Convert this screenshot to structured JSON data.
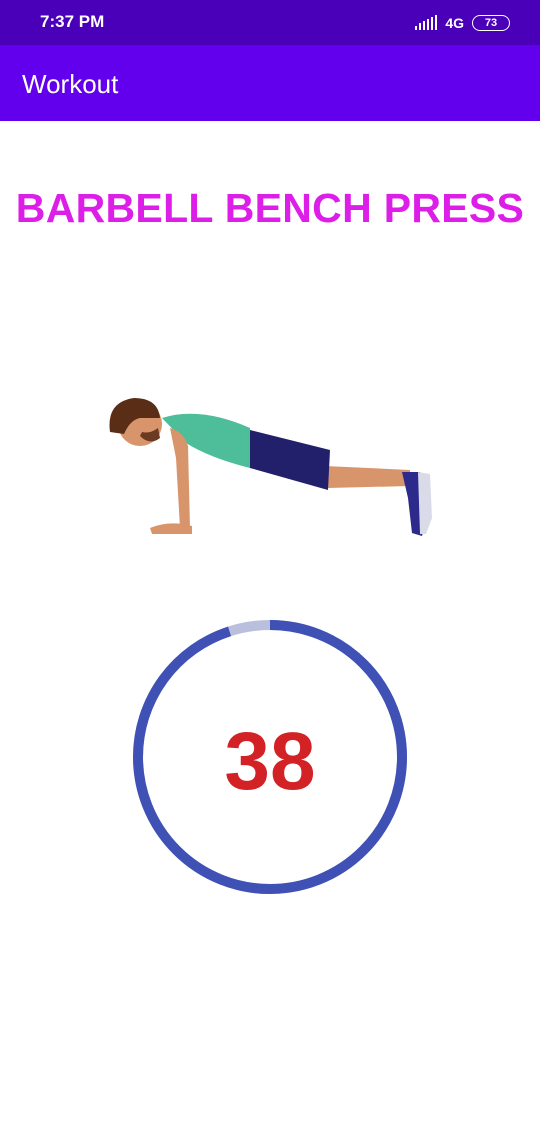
{
  "status_bar": {
    "time": "7:37 PM",
    "network": "4G",
    "battery": "73",
    "icons": [
      "signal-icon",
      "battery-icon"
    ]
  },
  "app_bar": {
    "title": "Workout"
  },
  "exercise": {
    "name": "BARBELL BENCH PRESS",
    "illustration_icon": "push-up-illustration"
  },
  "timer": {
    "remaining": "38",
    "progress_fraction": 0.95,
    "colors": {
      "track": "#b9bfdc",
      "progress": "#3f51b5",
      "text": "#d32226"
    }
  },
  "colors": {
    "status_bar": "#4a00b8",
    "app_bar": "#6200ee",
    "title": "#dd1ee8"
  }
}
